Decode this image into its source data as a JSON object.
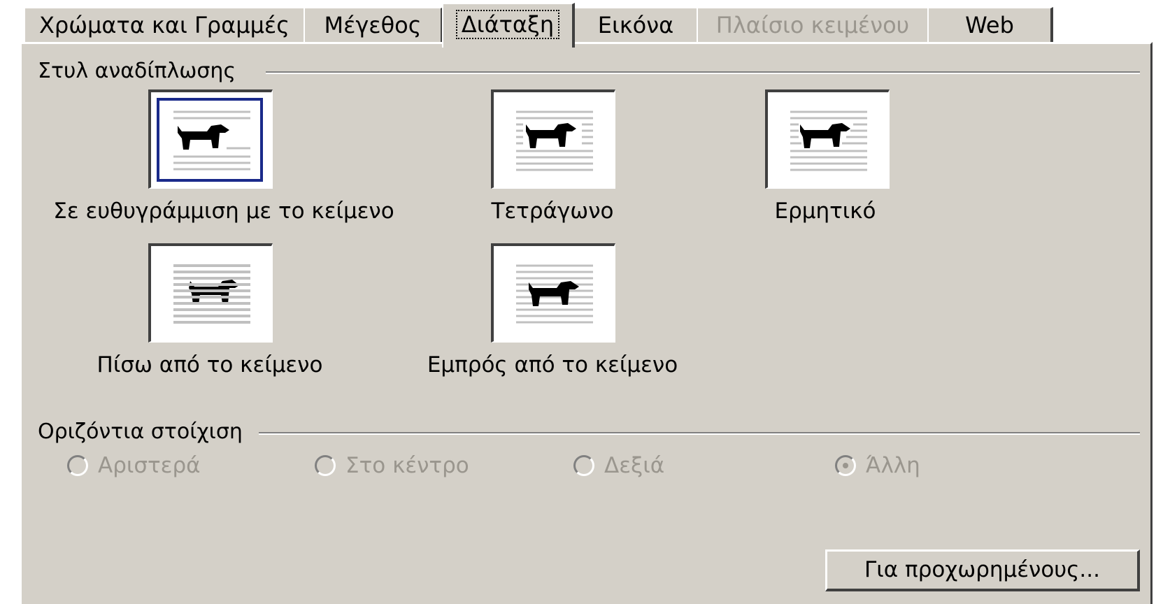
{
  "tabs": [
    {
      "label": "Χρώματα και Γραμμές",
      "state": "normal"
    },
    {
      "label": "Μέγεθος",
      "state": "normal"
    },
    {
      "label": "Διάταξη",
      "state": "active"
    },
    {
      "label": "Εικόνα",
      "state": "normal"
    },
    {
      "label": "Πλαίσιο κειμένου",
      "state": "disabled"
    },
    {
      "label": "Web",
      "state": "normal"
    }
  ],
  "wrapping": {
    "title": "Στυλ αναδίπλωσης",
    "options": [
      {
        "label": "Σε ευθυγράμμιση με το κείμενο",
        "icon": "inline-with-text-icon",
        "selected": true
      },
      {
        "label": "Τετράγωνο",
        "icon": "square-wrap-icon",
        "selected": false
      },
      {
        "label": "Ερμητικό",
        "icon": "tight-wrap-icon",
        "selected": false
      },
      {
        "label": "Πίσω από το κείμενο",
        "icon": "behind-text-icon",
        "selected": false
      },
      {
        "label": "Εμπρός από το κείμενο",
        "icon": "in-front-of-text-icon",
        "selected": false
      }
    ]
  },
  "alignment": {
    "title": "Οριζόντια στοίχιση",
    "options": [
      {
        "label": "Αριστερά",
        "checked": false
      },
      {
        "label": "Στο κέντρο",
        "checked": false
      },
      {
        "label": "Δεξιά",
        "checked": false
      },
      {
        "label": "Άλλη",
        "checked": true
      }
    ],
    "enabled": false
  },
  "advanced_button": "Για προχωρημένους...",
  "colors": {
    "face": "#d4d0c8",
    "selection": "#1a2a8a",
    "disabled_text": "#9a968e"
  }
}
